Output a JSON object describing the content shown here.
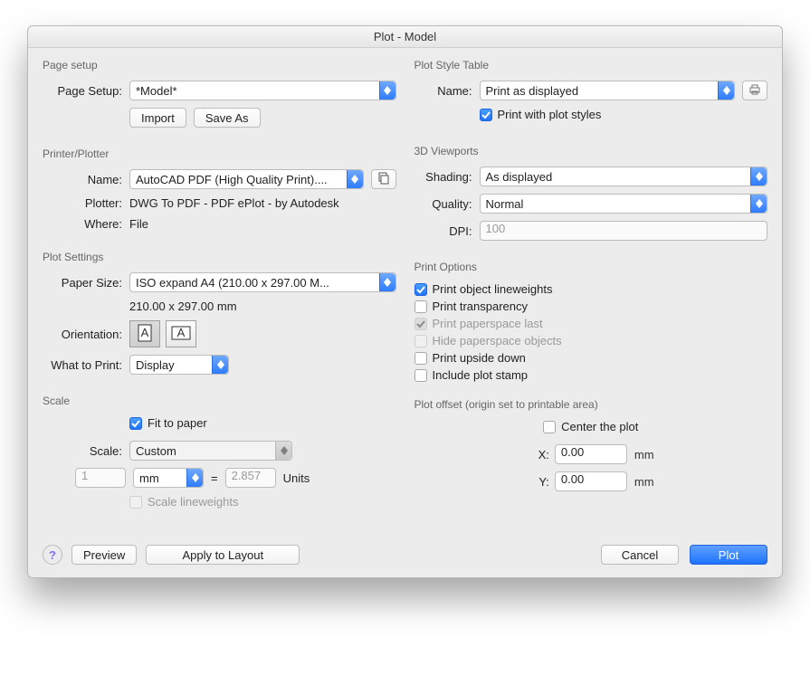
{
  "title": "Plot - Model",
  "pageSetup": {
    "legend": "Page setup",
    "label": "Page Setup:",
    "value": "*Model*",
    "import": "Import",
    "saveAs": "Save As"
  },
  "printer": {
    "legend": "Printer/Plotter",
    "nameLabel": "Name:",
    "nameValue": "AutoCAD PDF (High Quality Print)....",
    "plotterLabel": "Plotter:",
    "plotterValue": "DWG To PDF - PDF ePlot - by Autodesk",
    "whereLabel": "Where:",
    "whereValue": "File"
  },
  "plotSettings": {
    "legend": "Plot Settings",
    "paperSizeLabel": "Paper Size:",
    "paperSizeValue": "ISO expand A4 (210.00 x 297.00 M...",
    "paperDims": "210.00 x 297.00 mm",
    "orientationLabel": "Orientation:",
    "whatLabel": "What to Print:",
    "whatValue": "Display"
  },
  "scale": {
    "legend": "Scale",
    "fit": "Fit to paper",
    "scaleLabel": "Scale:",
    "scaleValue": "Custom",
    "num": "1",
    "unitSel": "mm",
    "eq": "=",
    "denom": "2.857",
    "units": "Units",
    "lw": "Scale lineweights"
  },
  "plotStyle": {
    "legend": "Plot Style Table",
    "nameLabel": "Name:",
    "nameValue": "Print as displayed",
    "printWith": "Print with plot styles"
  },
  "viewports": {
    "legend": "3D Viewports",
    "shadingLabel": "Shading:",
    "shadingValue": "As displayed",
    "qualityLabel": "Quality:",
    "qualityValue": "Normal",
    "dpiLabel": "DPI:",
    "dpiValue": "100"
  },
  "options": {
    "legend": "Print Options",
    "o1": "Print object lineweights",
    "o2": "Print transparency",
    "o3": "Print paperspace last",
    "o4": "Hide paperspace objects",
    "o5": "Print upside down",
    "o6": "Include plot stamp"
  },
  "offset": {
    "legend": "Plot offset (origin set to printable area)",
    "center": "Center the plot",
    "xLabel": "X:",
    "xValue": "0.00",
    "yLabel": "Y:",
    "yValue": "0.00",
    "mm": "mm"
  },
  "bottom": {
    "preview": "Preview",
    "apply": "Apply to Layout",
    "cancel": "Cancel",
    "plot": "Plot"
  }
}
